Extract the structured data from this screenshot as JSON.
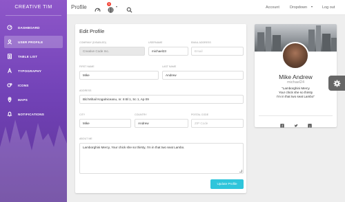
{
  "sidebar": {
    "brand": "CREATIVE TIM",
    "items": [
      {
        "label": "DASHBOARD",
        "icon": "dashboard-icon"
      },
      {
        "label": "USER PROFILE",
        "icon": "user-icon",
        "active": true
      },
      {
        "label": "TABLE LIST",
        "icon": "list-icon"
      },
      {
        "label": "TYPOGRAPHY",
        "icon": "typography-icon"
      },
      {
        "label": "ICONS",
        "icon": "bubble-icon"
      },
      {
        "label": "MAPS",
        "icon": "map-pin-icon"
      },
      {
        "label": "NOTIFICATIONS",
        "icon": "bell-icon"
      }
    ]
  },
  "topbar": {
    "title": "Profile",
    "notification_count": "5",
    "links": {
      "account": "Account",
      "dropdown": "Dropdown",
      "logout": "Log out"
    }
  },
  "edit_profile": {
    "title": "Edit Profile",
    "company": {
      "label": "Company (disabled)",
      "value": "Creative Code Inc."
    },
    "username": {
      "label": "Username",
      "value": "michael23"
    },
    "email": {
      "label": "Email address",
      "placeholder": "Email"
    },
    "first_name": {
      "label": "First Name",
      "value": "Mike"
    },
    "last_name": {
      "label": "Last Name",
      "value": "Andrew"
    },
    "address": {
      "label": "Address",
      "value": "Bld Mihail Kogalniceanu, nr. 8 Bl 1, Sc 1, Ap 09"
    },
    "city": {
      "label": "City",
      "value": "Mike"
    },
    "country": {
      "label": "Country",
      "value": "Andrew"
    },
    "postal": {
      "label": "Postal Code",
      "placeholder": "ZIP Code"
    },
    "about": {
      "label": "About Me",
      "value": "Lamborghini Mercy, Your chick she so thirsty, I'm in that two seat Lambo."
    },
    "button": "Update Profile"
  },
  "profile": {
    "name": "Mike Andrew",
    "username": "michael24",
    "bio_lines": [
      "\"Lamborghini Mercy",
      "Your chick she so thirsty",
      "I'm in that two seat Lambo\""
    ]
  },
  "colors": {
    "accent": "#2fc5db",
    "sidebar_top": "#8e57c9",
    "sidebar_bottom": "#5c3396",
    "badge": "#f44336"
  }
}
